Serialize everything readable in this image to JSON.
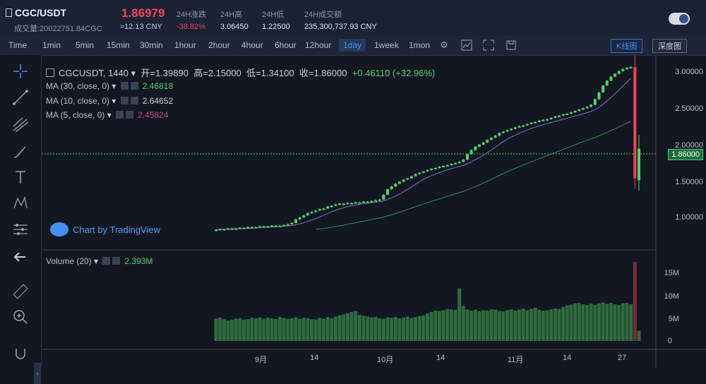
{
  "header": {
    "pair": "CGC/USDT",
    "volume_label": "成交量:20022751.84CGC",
    "price": "1.86979",
    "cny": "≈12.13 CNY",
    "stats": [
      {
        "label": "24H涨跌",
        "value": "-38.82%"
      },
      {
        "label": "24H高",
        "value": "3.06450"
      },
      {
        "label": "24H低",
        "value": "1.22500"
      },
      {
        "label": "24H成交额",
        "value": "235,300,737.93 CNY"
      }
    ]
  },
  "toolbar": {
    "intervals": [
      "Time",
      "1min",
      "5min",
      "15min",
      "30min",
      "1hour",
      "2hour",
      "4hour",
      "6hour",
      "12hour",
      "1day",
      "1week",
      "1mon"
    ],
    "active_interval": "1day",
    "icons": [
      "settings-icon",
      "indicator-icon",
      "fullscreen-icon",
      "save-icon"
    ],
    "kline_label": "K线图",
    "depth_label": "深度图"
  },
  "left_tools": [
    "crosshair-icon",
    "trendline-icon",
    "pitchfork-icon",
    "brush-icon",
    "text-icon",
    "pattern-icon",
    "fib-icon",
    "back-arrow-icon",
    "ruler-icon",
    "zoom-in-icon",
    "magnet-icon"
  ],
  "chart": {
    "symbol": "CGCUSDT",
    "resolution": "1440",
    "open_label": "开=1.39890",
    "high_label": "高=2.15000",
    "low_label": "低=1.34100",
    "close_label": "收=1.86000",
    "change_label": "+0.46110 (+32.96%)",
    "ma": [
      {
        "label": "MA (30, close, 0)",
        "value": "2.46818",
        "color": "#53d16b"
      },
      {
        "label": "MA (10, close, 0)",
        "value": "2.64652",
        "color": "#c9ced8"
      },
      {
        "label": "MA (5, close, 0)",
        "value": "2.45824",
        "color": "#c2478a"
      }
    ],
    "watermark": "Chart by TradingView",
    "volume_label": "Volume (20)",
    "volume_value": "2.393M",
    "current_price_tag": "1.86000",
    "price_axis": [
      "3.00000",
      "2.50000",
      "2.00000",
      "1.50000",
      "1.00000"
    ],
    "volume_axis": [
      "15M",
      "10M",
      "5M",
      "0"
    ],
    "x_labels": [
      "9月",
      "14",
      "10月",
      "14",
      "11月",
      "14",
      "27"
    ]
  },
  "chart_data": {
    "type": "candlestick",
    "price_range": [
      0.5,
      3.1
    ],
    "volume_range": [
      0,
      19
    ],
    "up_color": "#53d16b",
    "down_color": "#f0455a",
    "approx_close_series": [
      0.68,
      0.69,
      0.69,
      0.7,
      0.7,
      0.7,
      0.71,
      0.71,
      0.72,
      0.72,
      0.72,
      0.73,
      0.73,
      0.73,
      0.74,
      0.74,
      0.74,
      0.75,
      0.76,
      0.78,
      0.83,
      0.86,
      0.89,
      0.92,
      0.94,
      0.96,
      0.98,
      0.99,
      1.02,
      1.03,
      1.05,
      1.06,
      1.06,
      1.07,
      1.07,
      1.08,
      1.08,
      1.09,
      1.09,
      1.1,
      1.11,
      1.12,
      1.19,
      1.27,
      1.31,
      1.35,
      1.38,
      1.41,
      1.43,
      1.46,
      1.49,
      1.51,
      1.53,
      1.55,
      1.57,
      1.58,
      1.6,
      1.61,
      1.62,
      1.64,
      1.65,
      1.67,
      1.7,
      1.78,
      1.84,
      1.89,
      1.92,
      1.95,
      1.99,
      2.02,
      2.05,
      2.09,
      2.11,
      2.13,
      2.15,
      2.17,
      2.19,
      2.2,
      2.22,
      2.24,
      2.25,
      2.27,
      2.28,
      2.29,
      2.31,
      2.33,
      2.34,
      2.36,
      2.37,
      2.39,
      2.41,
      2.43,
      2.45,
      2.47,
      2.5,
      2.58,
      2.68,
      2.78,
      2.85,
      2.91,
      2.95,
      2.99,
      3.02,
      3.04,
      3.05,
      1.43,
      1.86
    ],
    "approx_volume_M": [
      5.2,
      5.5,
      5.1,
      4.8,
      5.0,
      5.2,
      5.3,
      5.0,
      5.1,
      5.4,
      5.3,
      5.5,
      5.2,
      5.4,
      5.3,
      5.1,
      5.6,
      5.4,
      5.2,
      5.3,
      5.5,
      5.2,
      5.4,
      5.3,
      5.1,
      5.0,
      5.4,
      5.2,
      5.6,
      5.3,
      5.7,
      6.0,
      6.2,
      6.5,
      6.8,
      7.0,
      6.1,
      5.9,
      5.7,
      5.5,
      5.6,
      5.3,
      5.2,
      5.5,
      5.4,
      5.6,
      5.3,
      5.5,
      5.7,
      5.4,
      5.6,
      5.8,
      6.0,
      6.4,
      6.8,
      7.1,
      7.0,
      7.2,
      7.5,
      7.4,
      7.3,
      12.3,
      8.2,
      7.3,
      7.1,
      7.3,
      7.0,
      7.2,
      7.1,
      7.4,
      7.3,
      7.0,
      6.9,
      7.2,
      7.4,
      7.1,
      7.3,
      7.6,
      7.2,
      7.5,
      7.8,
      7.3,
      7.1,
      7.2,
      7.4,
      7.6,
      7.5,
      8.0,
      8.3,
      8.5,
      8.8,
      8.9,
      8.6,
      8.4,
      8.7,
      8.5,
      8.8,
      9.0,
      8.7,
      8.9,
      8.6,
      8.4,
      8.8,
      8.9,
      8.6,
      18.5,
      2.4
    ]
  }
}
